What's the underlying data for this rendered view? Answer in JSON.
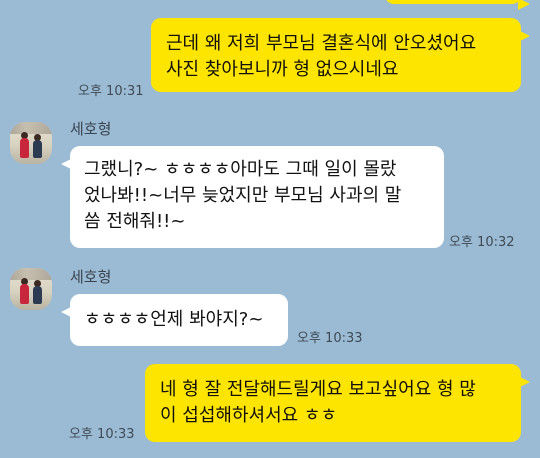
{
  "messages": [
    {
      "id": "m0",
      "from": "me",
      "lines": [
        "근데 왜 저희 부모님 결혼식에 안오셨어요",
        "사진 찾아보니까 형 없으시네요"
      ],
      "time": "오후 10:31"
    },
    {
      "id": "m1",
      "from": "세호형",
      "sender": "세호형",
      "lines": [
        "그랬니?~ ㅎㅎㅎㅎ아마도 그때 일이 몰랐",
        "었나봐!!~너무 늦었지만 부모님 사과의 말",
        "씀 전해줘!!~"
      ],
      "time": "오후 10:32"
    },
    {
      "id": "m2",
      "from": "세호형",
      "sender": "세호형",
      "lines": [
        "ㅎㅎㅎㅎ언제 봐야지?~"
      ],
      "time": "오후 10:33"
    },
    {
      "id": "m3",
      "from": "me",
      "lines": [
        "네 형 잘 전달해드릴게요 보고싶어요 형 많",
        "이 섭섭해하셔서요 ㅎㅎ"
      ],
      "time": "오후 10:33"
    }
  ],
  "colors": {
    "background": "#9bbbd4",
    "my_bubble": "#fee500",
    "their_bubble": "#ffffff"
  }
}
